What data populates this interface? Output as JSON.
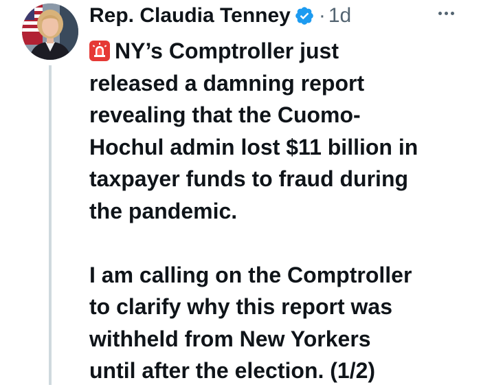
{
  "author": {
    "display_name": "Rep. Claudia Tenney",
    "separator": "·",
    "time": "1d",
    "verified_icon": "verified-badge-icon",
    "avatar": "profile-photo"
  },
  "more_icon": "more-options-icon",
  "tweet": {
    "emoji": "police-car-light",
    "paragraph1": [
      "NY’s Comptroller just",
      "released a damning report",
      "revealing that the Cuomo-",
      "Hochul admin lost $11 billion in",
      "taxpayer funds to fraud during",
      "the pandemic."
    ],
    "paragraph2": [
      "I am calling on the Comptroller",
      "to clarify why this report was",
      "withheld from New Yorkers",
      "until after the election. (1/2)"
    ]
  },
  "colors": {
    "text": "#0f1419",
    "muted": "#536471",
    "verified": "#1d9bf0",
    "thread_line": "#cfd9de",
    "siren": "#e53935"
  }
}
